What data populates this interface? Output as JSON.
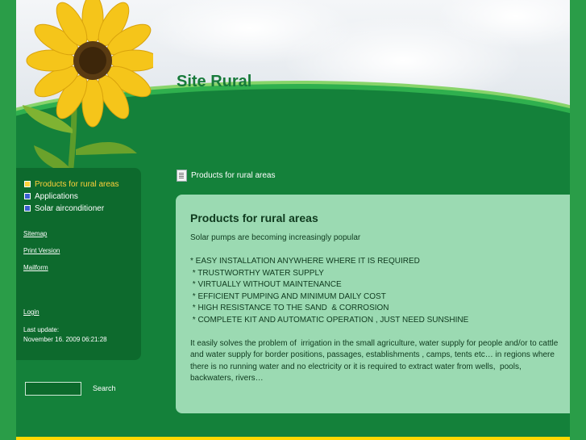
{
  "site": {
    "title": "Site Rural"
  },
  "nav": {
    "items": [
      {
        "label": "Products for rural areas",
        "active": true
      },
      {
        "label": "Applications",
        "active": false
      },
      {
        "label": "Solar airconditioner",
        "active": false
      }
    ]
  },
  "sidebar_links": {
    "sitemap": "Sitemap",
    "print_version": "Print Version",
    "mailform": "Mailform",
    "login": "Login",
    "last_update_label": "Last update:",
    "last_update_value": "November 16. 2009 06:21:28"
  },
  "search": {
    "button_label": "Search",
    "input_value": ""
  },
  "breadcrumb": {
    "label": "Products for rural areas"
  },
  "content": {
    "title": "Products for rural areas",
    "body": "Solar pumps are becoming increasingly popular\n\n* EASY INSTALLATION ANYWHERE WHERE IT IS REQUIRED\n * TRUSTWORTHY WATER SUPPLY\n * VIRTUALLY WITHOUT MAINTENANCE\n * EFFICIENT PUMPING AND MINIMUM DAILY COST\n * HIGH RESISTANCE TO THE SAND  & CORROSION\n * COMPLETE KIT AND AUTOMATIC OPERATION , JUST NEED SUNSHINE\n\nIt easily solves the problem of  irrigation in the small agriculture, water supply for people and/or to cattle and water supply for border positions, passages, establishments , camps, tents etc… in regions where there is no running water and no electricity or it is required to extract water from wells,  pools, backwaters, rivers…"
  },
  "colors": {
    "background_green": "#14813a",
    "sidebar_green": "#0d6a2d",
    "content_box": "#9bdab2",
    "title_green": "#177a3a",
    "active_nav": "#ffd23a",
    "bottom_bar": "#ffd800"
  },
  "icons": {
    "breadcrumb": "document-icon",
    "header_art": "sunflower-icon"
  }
}
